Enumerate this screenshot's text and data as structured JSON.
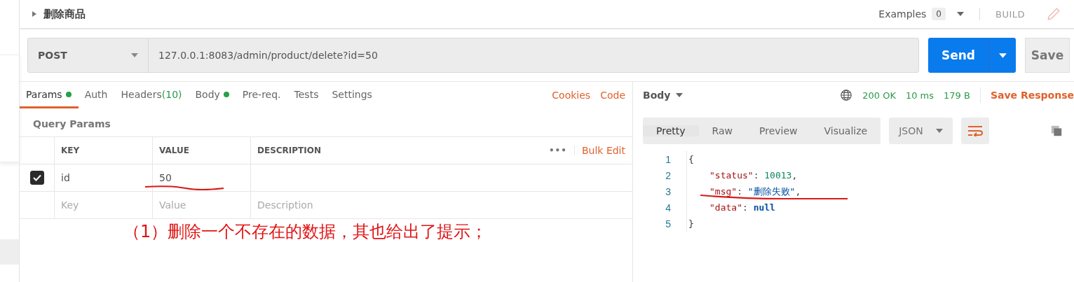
{
  "request": {
    "name": "删除商品",
    "method": "POST",
    "url": "127.0.0.1:8083/admin/product/delete?id=50"
  },
  "header": {
    "examples_label": "Examples",
    "examples_count": "0",
    "build": "BUILD"
  },
  "send_button": "Send",
  "save_button": "Save",
  "tabs": [
    {
      "label": "Params",
      "selected": true,
      "dot": true
    },
    {
      "label": "Auth",
      "selected": false,
      "dot": false
    },
    {
      "label": "Headers",
      "count": "(10)",
      "selected": false,
      "dot": false
    },
    {
      "label": "Body",
      "selected": false,
      "dot": true
    },
    {
      "label": "Pre-req.",
      "selected": false,
      "dot": false
    },
    {
      "label": "Tests",
      "selected": false,
      "dot": false
    },
    {
      "label": "Settings",
      "selected": false,
      "dot": false
    }
  ],
  "links": [
    "Cookies",
    "Code"
  ],
  "query_params": {
    "title": "Query Params",
    "columns": [
      "KEY",
      "VALUE",
      "DESCRIPTION"
    ],
    "more": "•••",
    "bulk_edit": "Bulk Edit",
    "rows": [
      {
        "key": "id",
        "value": "50",
        "checked": true
      }
    ],
    "placeholder_row": {
      "key": "Key",
      "value": "Value",
      "description": "Description"
    }
  },
  "annotation": "（1）删除一个不存在的数据，其也给出了提示；",
  "response": {
    "body_label": "Body",
    "status": "200 OK",
    "time": "10 ms",
    "size": "179 B",
    "save_response": "Save Response",
    "view_tabs": [
      {
        "label": "Pretty",
        "selected": true
      },
      {
        "label": "Raw",
        "selected": false
      },
      {
        "label": "Preview",
        "selected": false
      },
      {
        "label": "Visualize",
        "selected": false
      }
    ],
    "format": "JSON",
    "lines": [
      {
        "number": "1",
        "tokens": [
          {
            "kind": "punct",
            "text": "{"
          }
        ]
      },
      {
        "number": "2",
        "tokens": [
          {
            "kind": "key",
            "text": "\"status\""
          },
          {
            "kind": "punct",
            "text": ": "
          },
          {
            "kind": "number",
            "text": "10013"
          },
          {
            "kind": "punct",
            "text": ","
          }
        ]
      },
      {
        "number": "3",
        "tokens": [
          {
            "kind": "key",
            "text": "\"msg\""
          },
          {
            "kind": "punct",
            "text": ": "
          },
          {
            "kind": "string",
            "text": "\"删除失败\""
          },
          {
            "kind": "punct",
            "text": ","
          }
        ]
      },
      {
        "number": "4",
        "tokens": [
          {
            "kind": "key",
            "text": "\"data\""
          },
          {
            "kind": "punct",
            "text": ": "
          },
          {
            "kind": "null",
            "text": "null"
          }
        ]
      },
      {
        "number": "5",
        "tokens": [
          {
            "kind": "punct",
            "text": "}"
          }
        ]
      }
    ]
  }
}
